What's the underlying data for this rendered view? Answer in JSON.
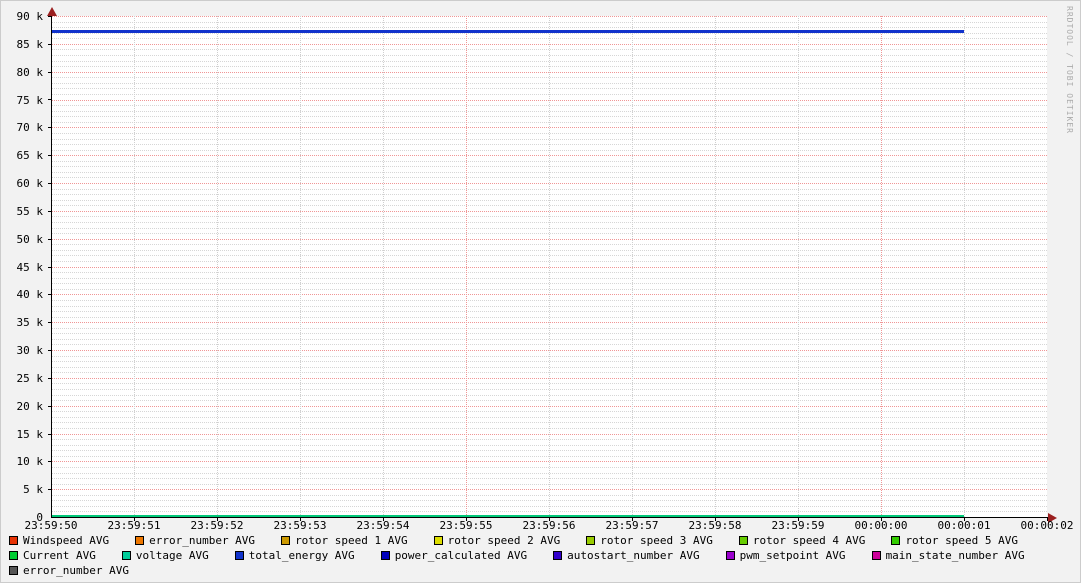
{
  "watermark": "RRDTOOL / TOBI OETIKER",
  "colors": {
    "background": "#F2F2F2",
    "canvas": "#FFFFFF",
    "border": "#CCCCCC",
    "axis": "#000000",
    "arrow": "#9B2020",
    "grid_major": "#F09696",
    "grid_minor": "#D6D6D6",
    "zero_line": "#00C878"
  },
  "chart_data": {
    "type": "line",
    "title": "",
    "xlabel": "",
    "ylabel": "",
    "ylim": [
      0,
      90000
    ],
    "y_major_step": 5000,
    "y_minor_step": 1000,
    "y_tick_labels": [
      "0",
      "5 k",
      "10 k",
      "15 k",
      "20 k",
      "25 k",
      "30 k",
      "35 k",
      "40 k",
      "45 k",
      "50 k",
      "55 k",
      "60 k",
      "65 k",
      "70 k",
      "75 k",
      "80 k",
      "85 k",
      "90 k"
    ],
    "x_ticks": [
      "23:59:50",
      "23:59:51",
      "23:59:52",
      "23:59:53",
      "23:59:54",
      "23:59:55",
      "23:59:56",
      "23:59:57",
      "23:59:58",
      "23:59:59",
      "00:00:00",
      "00:00:01",
      "00:00:02"
    ],
    "x_major_tick_indices": [
      5,
      10
    ],
    "x_data_start": "23:59:50",
    "x_data_end": "00:00:01",
    "grid": true,
    "legend_position": "bottom",
    "series": [
      {
        "name": "Windspeed AVG",
        "color": "#E73305",
        "value": 0
      },
      {
        "name": "error_number AVG",
        "color": "#EE7700",
        "value": 0
      },
      {
        "name": "rotor speed 1 AVG",
        "color": "#CC9900",
        "value": 0
      },
      {
        "name": "rotor speed 2 AVG",
        "color": "#DDDD00",
        "value": 0
      },
      {
        "name": "rotor speed 3 AVG",
        "color": "#99CC00",
        "value": 0
      },
      {
        "name": "rotor speed 4 AVG",
        "color": "#66CC00",
        "value": 0
      },
      {
        "name": "rotor speed 5 AVG",
        "color": "#33CC00",
        "value": 0
      },
      {
        "name": "Current AVG",
        "color": "#00CC33",
        "value": 0
      },
      {
        "name": "voltage AVG",
        "color": "#00CC99",
        "value": 0
      },
      {
        "name": "total_energy AVG",
        "color": "#1133CC",
        "value": 87300
      },
      {
        "name": "power_calculated AVG",
        "color": "#0000BB",
        "value": 0
      },
      {
        "name": "autostart_number AVG",
        "color": "#3300CC",
        "value": 0
      },
      {
        "name": "pwm_setpoint AVG",
        "color": "#9900CC",
        "value": 0
      },
      {
        "name": "main_state_number AVG",
        "color": "#CC0099",
        "value": 0
      },
      {
        "name": "error_number AVG",
        "color": "#555555",
        "value": 0
      }
    ]
  },
  "legend": {
    "rows": [
      [
        0,
        1,
        2,
        3,
        4,
        5,
        6
      ],
      [
        7,
        8,
        9,
        10,
        11,
        12,
        13
      ],
      [
        14
      ]
    ]
  }
}
